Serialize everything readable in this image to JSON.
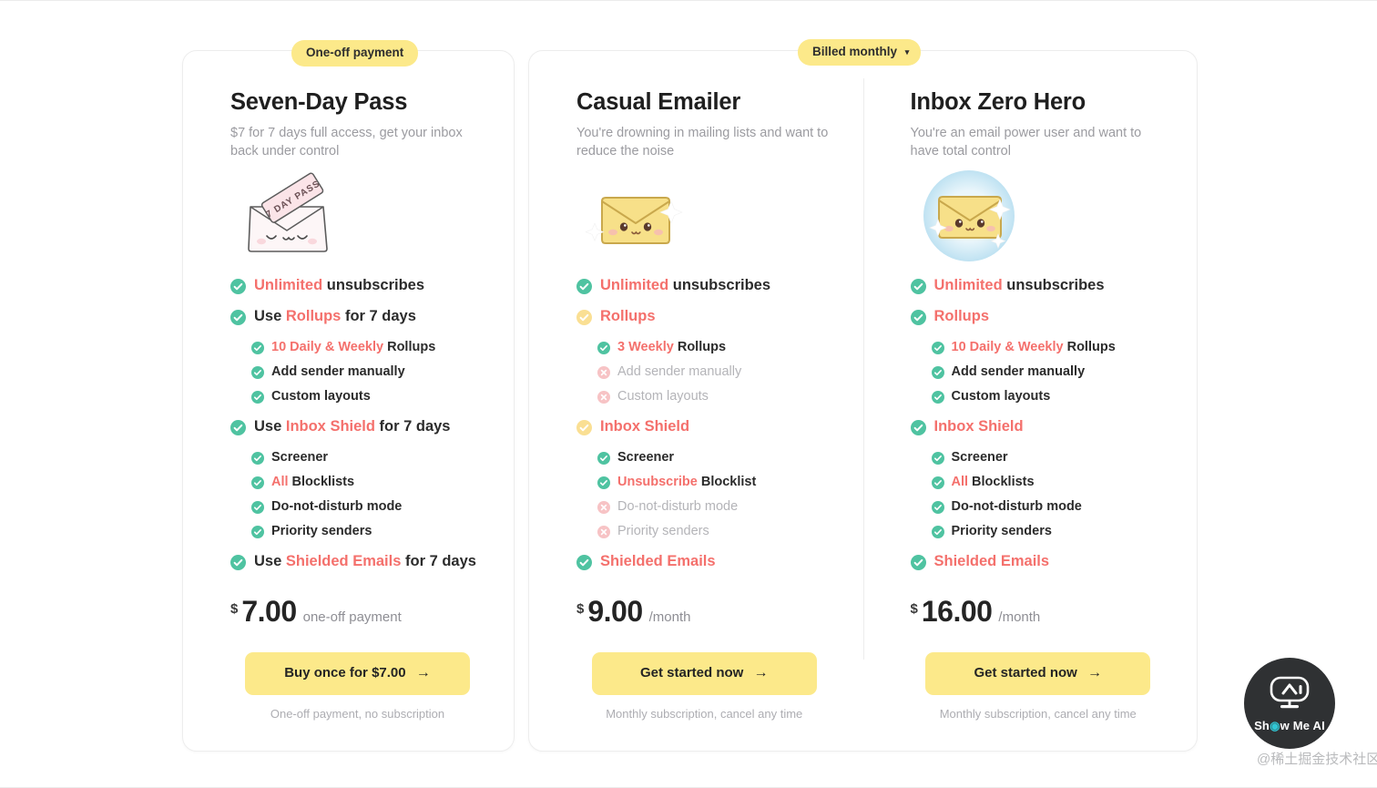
{
  "badges": {
    "one_off": "One-off payment",
    "billed_monthly": "Billed monthly",
    "caret": "▾"
  },
  "colors": {
    "accent_yellow": "#fce98a",
    "highlight_red": "#f4706c",
    "check_green": "#4fc3a1",
    "check_amber": "#fadf93",
    "cross_pink": "#f7c3c5",
    "text_dark": "#2b2b2b",
    "text_muted": "#9b9ba0"
  },
  "plans": [
    {
      "title": "Seven-Day Pass",
      "subtitle": "$7 for 7 days full access, get your inbox back under control",
      "illustration": "envelope-seven-day-pass-icon",
      "features": [
        {
          "icon": "check-green-icon",
          "state": "yes",
          "level": "main",
          "parts": [
            {
              "t": "Unlimited",
              "hl": true
            },
            {
              "t": " unsubscribes",
              "hl": false
            }
          ]
        },
        {
          "icon": "check-green-icon",
          "state": "yes",
          "level": "main",
          "group": true,
          "parts": [
            {
              "t": "Use ",
              "hl": false
            },
            {
              "t": "Rollups",
              "hl": true
            },
            {
              "t": " for 7 days",
              "hl": false
            }
          ]
        },
        {
          "icon": "check-green-icon",
          "state": "yes",
          "level": "sub",
          "subsStart": true,
          "parts": [
            {
              "t": "10 Daily & Weekly",
              "hl": true
            },
            {
              "t": " Rollups",
              "hl": false
            }
          ]
        },
        {
          "icon": "check-green-icon",
          "state": "yes",
          "level": "sub",
          "parts": [
            {
              "t": "Add sender manually",
              "hl": false
            }
          ]
        },
        {
          "icon": "check-green-icon",
          "state": "yes",
          "level": "sub",
          "parts": [
            {
              "t": "Custom layouts",
              "hl": false
            }
          ]
        },
        {
          "icon": "check-green-icon",
          "state": "yes",
          "level": "main",
          "group": true,
          "parts": [
            {
              "t": "Use ",
              "hl": false
            },
            {
              "t": "Inbox Shield",
              "hl": true
            },
            {
              "t": " for 7 days",
              "hl": false
            }
          ]
        },
        {
          "icon": "check-green-icon",
          "state": "yes",
          "level": "sub",
          "subsStart": true,
          "parts": [
            {
              "t": "Screener",
              "hl": false
            }
          ]
        },
        {
          "icon": "check-green-icon",
          "state": "yes",
          "level": "sub",
          "parts": [
            {
              "t": "All",
              "hl": true
            },
            {
              "t": " Blocklists",
              "hl": false
            }
          ]
        },
        {
          "icon": "check-green-icon",
          "state": "yes",
          "level": "sub",
          "parts": [
            {
              "t": "Do-not-disturb mode",
              "hl": false
            }
          ]
        },
        {
          "icon": "check-green-icon",
          "state": "yes",
          "level": "sub",
          "parts": [
            {
              "t": "Priority senders",
              "hl": false
            }
          ]
        },
        {
          "icon": "check-green-icon",
          "state": "yes",
          "level": "main",
          "group": true,
          "parts": [
            {
              "t": "Use ",
              "hl": false
            },
            {
              "t": "Shielded Emails",
              "hl": true
            },
            {
              "t": " for 7 days",
              "hl": false
            }
          ]
        }
      ],
      "currency": "$",
      "amount": "7.00",
      "period": "one-off payment",
      "cta_label": "Buy once for $7.00",
      "cta_arrow": "→",
      "fineprint": "One-off payment, no subscription"
    },
    {
      "title": "Casual Emailer",
      "subtitle": "You're drowning in mailing lists and want to reduce the noise",
      "illustration": "envelope-sparkle-icon",
      "features": [
        {
          "icon": "check-green-icon",
          "state": "yes",
          "level": "main",
          "parts": [
            {
              "t": "Unlimited",
              "hl": true
            },
            {
              "t": " unsubscribes",
              "hl": false
            }
          ]
        },
        {
          "icon": "check-amber-icon",
          "state": "part",
          "level": "main",
          "group": true,
          "parts": [
            {
              "t": "Rollups",
              "hl": true
            }
          ]
        },
        {
          "icon": "check-green-icon",
          "state": "yes",
          "level": "sub",
          "subsStart": true,
          "parts": [
            {
              "t": "3 Weekly",
              "hl": true
            },
            {
              "t": " Rollups",
              "hl": false
            }
          ]
        },
        {
          "icon": "cross-pink-icon",
          "state": "no",
          "level": "sub",
          "parts": [
            {
              "t": "Add sender manually",
              "hl": false
            }
          ]
        },
        {
          "icon": "cross-pink-icon",
          "state": "no",
          "level": "sub",
          "parts": [
            {
              "t": "Custom layouts",
              "hl": false
            }
          ]
        },
        {
          "icon": "check-amber-icon",
          "state": "part",
          "level": "main",
          "group": true,
          "parts": [
            {
              "t": "Inbox Shield",
              "hl": true
            }
          ]
        },
        {
          "icon": "check-green-icon",
          "state": "yes",
          "level": "sub",
          "subsStart": true,
          "parts": [
            {
              "t": "Screener",
              "hl": false
            }
          ]
        },
        {
          "icon": "check-green-icon",
          "state": "yes",
          "level": "sub",
          "parts": [
            {
              "t": "Unsubscribe",
              "hl": true
            },
            {
              "t": " Blocklist",
              "hl": false
            }
          ]
        },
        {
          "icon": "cross-pink-icon",
          "state": "no",
          "level": "sub",
          "parts": [
            {
              "t": "Do-not-disturb mode",
              "hl": false
            }
          ]
        },
        {
          "icon": "cross-pink-icon",
          "state": "no",
          "level": "sub",
          "parts": [
            {
              "t": "Priority senders",
              "hl": false
            }
          ]
        },
        {
          "icon": "check-green-icon",
          "state": "yes",
          "level": "main",
          "group": true,
          "parts": [
            {
              "t": "Shielded Emails",
              "hl": true
            }
          ]
        }
      ],
      "currency": "$",
      "amount": "9.00",
      "period": "/month",
      "cta_label": "Get started now",
      "cta_arrow": "→",
      "fineprint": "Monthly subscription, cancel any time"
    },
    {
      "title": "Inbox Zero Hero",
      "subtitle": "You're an email power user and want to have total control",
      "illustration": "envelope-shielded-glow-icon",
      "features": [
        {
          "icon": "check-green-icon",
          "state": "yes",
          "level": "main",
          "parts": [
            {
              "t": "Unlimited",
              "hl": true
            },
            {
              "t": " unsubscribes",
              "hl": false
            }
          ]
        },
        {
          "icon": "check-green-icon",
          "state": "yes",
          "level": "main",
          "group": true,
          "parts": [
            {
              "t": "Rollups",
              "hl": true
            }
          ]
        },
        {
          "icon": "check-green-icon",
          "state": "yes",
          "level": "sub",
          "subsStart": true,
          "parts": [
            {
              "t": "10 Daily & Weekly",
              "hl": true
            },
            {
              "t": " Rollups",
              "hl": false
            }
          ]
        },
        {
          "icon": "check-green-icon",
          "state": "yes",
          "level": "sub",
          "parts": [
            {
              "t": "Add sender manually",
              "hl": false
            }
          ]
        },
        {
          "icon": "check-green-icon",
          "state": "yes",
          "level": "sub",
          "parts": [
            {
              "t": "Custom layouts",
              "hl": false
            }
          ]
        },
        {
          "icon": "check-green-icon",
          "state": "yes",
          "level": "main",
          "group": true,
          "parts": [
            {
              "t": "Inbox Shield",
              "hl": true
            }
          ]
        },
        {
          "icon": "check-green-icon",
          "state": "yes",
          "level": "sub",
          "subsStart": true,
          "parts": [
            {
              "t": "Screener",
              "hl": false
            }
          ]
        },
        {
          "icon": "check-green-icon",
          "state": "yes",
          "level": "sub",
          "parts": [
            {
              "t": "All",
              "hl": true
            },
            {
              "t": " Blocklists",
              "hl": false
            }
          ]
        },
        {
          "icon": "check-green-icon",
          "state": "yes",
          "level": "sub",
          "parts": [
            {
              "t": "Do-not-disturb mode",
              "hl": false
            }
          ]
        },
        {
          "icon": "check-green-icon",
          "state": "yes",
          "level": "sub",
          "parts": [
            {
              "t": "Priority senders",
              "hl": false
            }
          ]
        },
        {
          "icon": "check-green-icon",
          "state": "yes",
          "level": "main",
          "group": true,
          "parts": [
            {
              "t": "Shielded Emails",
              "hl": true
            }
          ]
        }
      ],
      "currency": "$",
      "amount": "16.00",
      "period": "/month",
      "cta_label": "Get started now",
      "cta_arrow": "→",
      "fineprint": "Monthly subscription, cancel any time"
    }
  ],
  "watermark": {
    "logo_text_before": "Sh",
    "logo_dot": "◉",
    "logo_text_after": "w Me AI",
    "logo_icon": "robot-monitor-icon",
    "chinese": "@稀土掘金技术社区"
  }
}
